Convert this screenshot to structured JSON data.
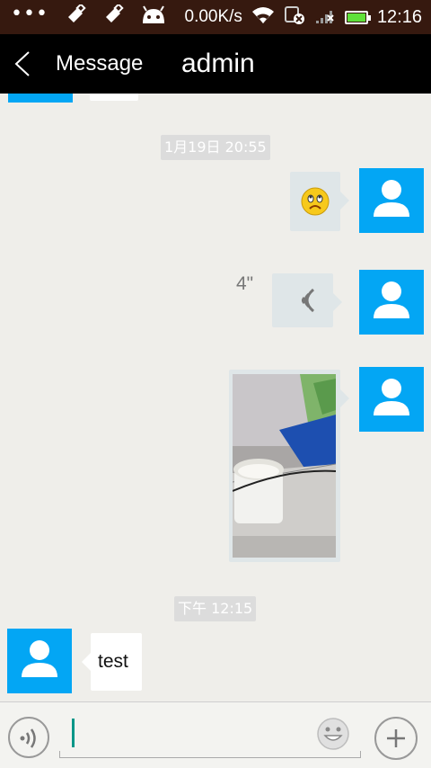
{
  "status_bar": {
    "dots": "•••",
    "network_speed": "0.00K/s",
    "time": "12:16",
    "battery_level": 0.9,
    "icons": [
      "usb-icon",
      "usb-debug-icon",
      "android-icon",
      "wifi-icon",
      "sim-blocked-icon",
      "no-signal-icon",
      "battery-icon"
    ]
  },
  "title_bar": {
    "back_icon": "chevron-left-icon",
    "section_label": "Message",
    "conversation_title": "admin"
  },
  "chat": {
    "timestamps": [
      "1月19日 20:55",
      "下午 12:15"
    ],
    "voice_duration": "4\"",
    "incoming_text": "test",
    "outgoing_emoji": "sad-face-emoji",
    "photo_description_icon": "photo-thumbnail"
  },
  "input_bar": {
    "voice_icon": "voice-input-icon",
    "text_value": "",
    "emoji_icon": "emoji-icon",
    "plus_icon": "plus-icon"
  },
  "colors": {
    "status_bar_bg": "#36190f",
    "title_bar_bg": "#000000",
    "chat_bg": "#efeeea",
    "avatar_blue": "#03a6f4",
    "cursor_teal": "#009688",
    "battery_green": "#5fe03a"
  }
}
